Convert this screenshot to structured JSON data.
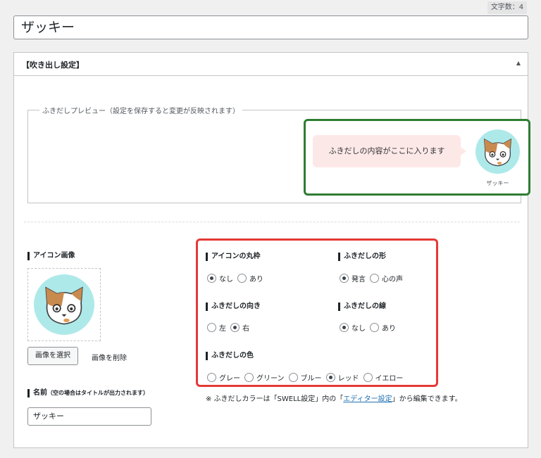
{
  "header": {
    "char_count": "文字数：4"
  },
  "post_title": "ザッキー",
  "panel": {
    "title": "【吹き出し設定】",
    "toggle": "▲"
  },
  "preview": {
    "legend": "ふきだしプレビュー（設定を保存すると変更が反映されます）",
    "bubble_text": "ふきだしの内容がここに入ります",
    "speaker_name": "ザッキー"
  },
  "icon_image": {
    "label": "アイコン画像",
    "select_button": "画像を選択",
    "delete_link": "画像を削除"
  },
  "name_field": {
    "label": "名前",
    "hint": "（空の場合はタイトルが出力されます）",
    "value": "ザッキー"
  },
  "options": {
    "round_frame": {
      "label": "アイコンの丸枠",
      "choices": [
        "なし",
        "あり"
      ],
      "selected": "なし"
    },
    "bubble_shape": {
      "label": "ふきだしの形",
      "choices": [
        "発言",
        "心の声"
      ],
      "selected": "発言"
    },
    "direction": {
      "label": "ふきだしの向き",
      "choices": [
        "左",
        "右"
      ],
      "selected": "右"
    },
    "border": {
      "label": "ふきだしの線",
      "choices": [
        "なし",
        "あり"
      ],
      "selected": "なし"
    },
    "color": {
      "label": "ふきだしの色",
      "choices": [
        "グレー",
        "グリーン",
        "ブルー",
        "レッド",
        "イエロー"
      ],
      "selected": "レッド"
    }
  },
  "note": {
    "prefix": "※ ふきだしカラーは「SWELL設定」内の「",
    "link": "エディター設定",
    "suffix": "」から編集できます。"
  },
  "colors": {
    "highlight_green": "#2e7d32",
    "highlight_red": "#e53935",
    "bubble_bg": "#fde8e8",
    "link": "#2271b1"
  }
}
